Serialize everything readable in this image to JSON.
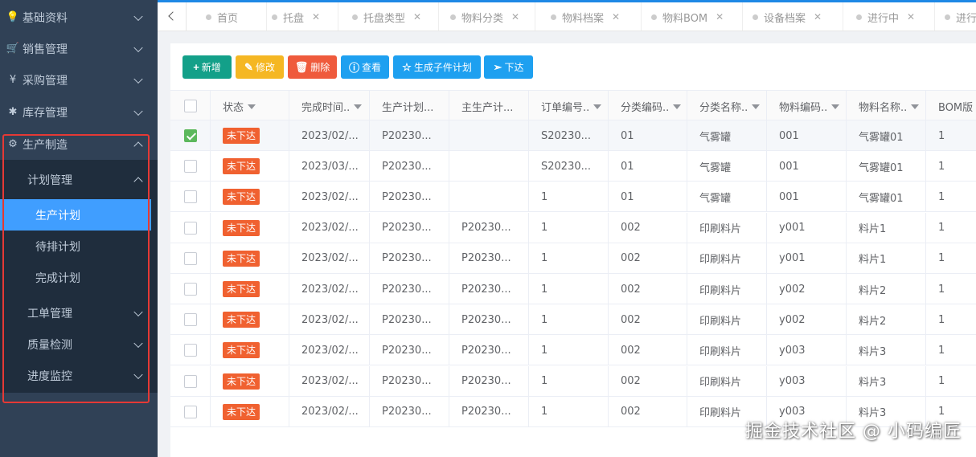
{
  "sidebar": {
    "items": [
      {
        "label": "基础资料",
        "icon": "lightbulb-icon",
        "glyph": "💡"
      },
      {
        "label": "销售管理",
        "icon": "cart-icon",
        "glyph": "🛒"
      },
      {
        "label": "采购管理",
        "icon": "yen-icon",
        "glyph": "¥"
      },
      {
        "label": "库存管理",
        "icon": "asterisk-icon",
        "glyph": "✱"
      },
      {
        "label": "生产制造",
        "icon": "gear-icon",
        "glyph": "⚙"
      }
    ],
    "plan_group": "计划管理",
    "plan_items": [
      "生产计划",
      "待排计划",
      "完成计划"
    ],
    "other_groups": [
      "工单管理",
      "质量检测",
      "进度监控"
    ]
  },
  "tabs": [
    {
      "label": "首页",
      "closable": false
    },
    {
      "label": "托盘",
      "closable": true
    },
    {
      "label": "托盘类型",
      "closable": true
    },
    {
      "label": "物料分类",
      "closable": true
    },
    {
      "label": "物料档案",
      "closable": true
    },
    {
      "label": "物料BOM",
      "closable": true
    },
    {
      "label": "设备档案",
      "closable": true
    },
    {
      "label": "进行中",
      "closable": true
    },
    {
      "label": "进行",
      "closable": false
    }
  ],
  "toolbar": {
    "add": "新增",
    "edit": "修改",
    "delete": "删除",
    "view": "查看",
    "generate": "生成子件计划",
    "issue": "下达"
  },
  "table": {
    "headers": [
      "状态",
      "完成时间..",
      "生产计划...",
      "主生产计...",
      "订单编号..",
      "分类编码..",
      "分类名称..",
      "物料编码..",
      "物料名称..",
      "BOM版"
    ],
    "filter_cols": [
      0,
      1,
      4,
      5,
      6,
      7,
      8
    ],
    "rows": [
      {
        "checked": true,
        "status": "未下达",
        "time": "2023/02/...",
        "plan": "P20230...",
        "master": "",
        "order": "S20230...",
        "cat_code": "01",
        "cat_name": "气雾罐",
        "mat_code": "001",
        "mat_name": "气雾罐01",
        "bom": "1"
      },
      {
        "checked": false,
        "status": "未下达",
        "time": "2023/03/...",
        "plan": "P20230...",
        "master": "",
        "order": "S20230...",
        "cat_code": "01",
        "cat_name": "气雾罐",
        "mat_code": "001",
        "mat_name": "气雾罐01",
        "bom": "1"
      },
      {
        "checked": false,
        "status": "未下达",
        "time": "2023/02/...",
        "plan": "P20230...",
        "master": "",
        "order": "1",
        "cat_code": "01",
        "cat_name": "气雾罐",
        "mat_code": "001",
        "mat_name": "气雾罐01",
        "bom": "1"
      },
      {
        "checked": false,
        "status": "未下达",
        "time": "2023/02/...",
        "plan": "P20230...",
        "master": "P20230...",
        "order": "1",
        "cat_code": "002",
        "cat_name": "印刷料片",
        "mat_code": "y001",
        "mat_name": "料片1",
        "bom": "1"
      },
      {
        "checked": false,
        "status": "未下达",
        "time": "2023/02/...",
        "plan": "P20230...",
        "master": "P20230...",
        "order": "1",
        "cat_code": "002",
        "cat_name": "印刷料片",
        "mat_code": "y001",
        "mat_name": "料片1",
        "bom": "1"
      },
      {
        "checked": false,
        "status": "未下达",
        "time": "2023/02/...",
        "plan": "P20230...",
        "master": "P20230...",
        "order": "1",
        "cat_code": "002",
        "cat_name": "印刷料片",
        "mat_code": "y002",
        "mat_name": "料片2",
        "bom": "1"
      },
      {
        "checked": false,
        "status": "未下达",
        "time": "2023/02/...",
        "plan": "P20230...",
        "master": "P20230...",
        "order": "1",
        "cat_code": "002",
        "cat_name": "印刷料片",
        "mat_code": "y002",
        "mat_name": "料片2",
        "bom": "1"
      },
      {
        "checked": false,
        "status": "未下达",
        "time": "2023/02/...",
        "plan": "P20230...",
        "master": "P20230...",
        "order": "1",
        "cat_code": "002",
        "cat_name": "印刷料片",
        "mat_code": "y003",
        "mat_name": "料片3",
        "bom": "1"
      },
      {
        "checked": false,
        "status": "未下达",
        "time": "2023/02/...",
        "plan": "P20230...",
        "master": "P20230...",
        "order": "1",
        "cat_code": "002",
        "cat_name": "印刷料片",
        "mat_code": "y003",
        "mat_name": "料片3",
        "bom": "1"
      },
      {
        "checked": false,
        "status": "未下达",
        "time": "2023/02/...",
        "plan": "P20230...",
        "master": "P20230...",
        "order": "1",
        "cat_code": "002",
        "cat_name": "印刷料片",
        "mat_code": "y003",
        "mat_name": "料片3",
        "bom": "1"
      }
    ]
  },
  "watermark": "掘金技术社区 @ 小码编匠",
  "colors": {
    "sidebar": "#304156",
    "submenu": "#1f2d3d",
    "active": "#409eff",
    "badge": "#f06130",
    "highlight_box": "#e53935"
  }
}
